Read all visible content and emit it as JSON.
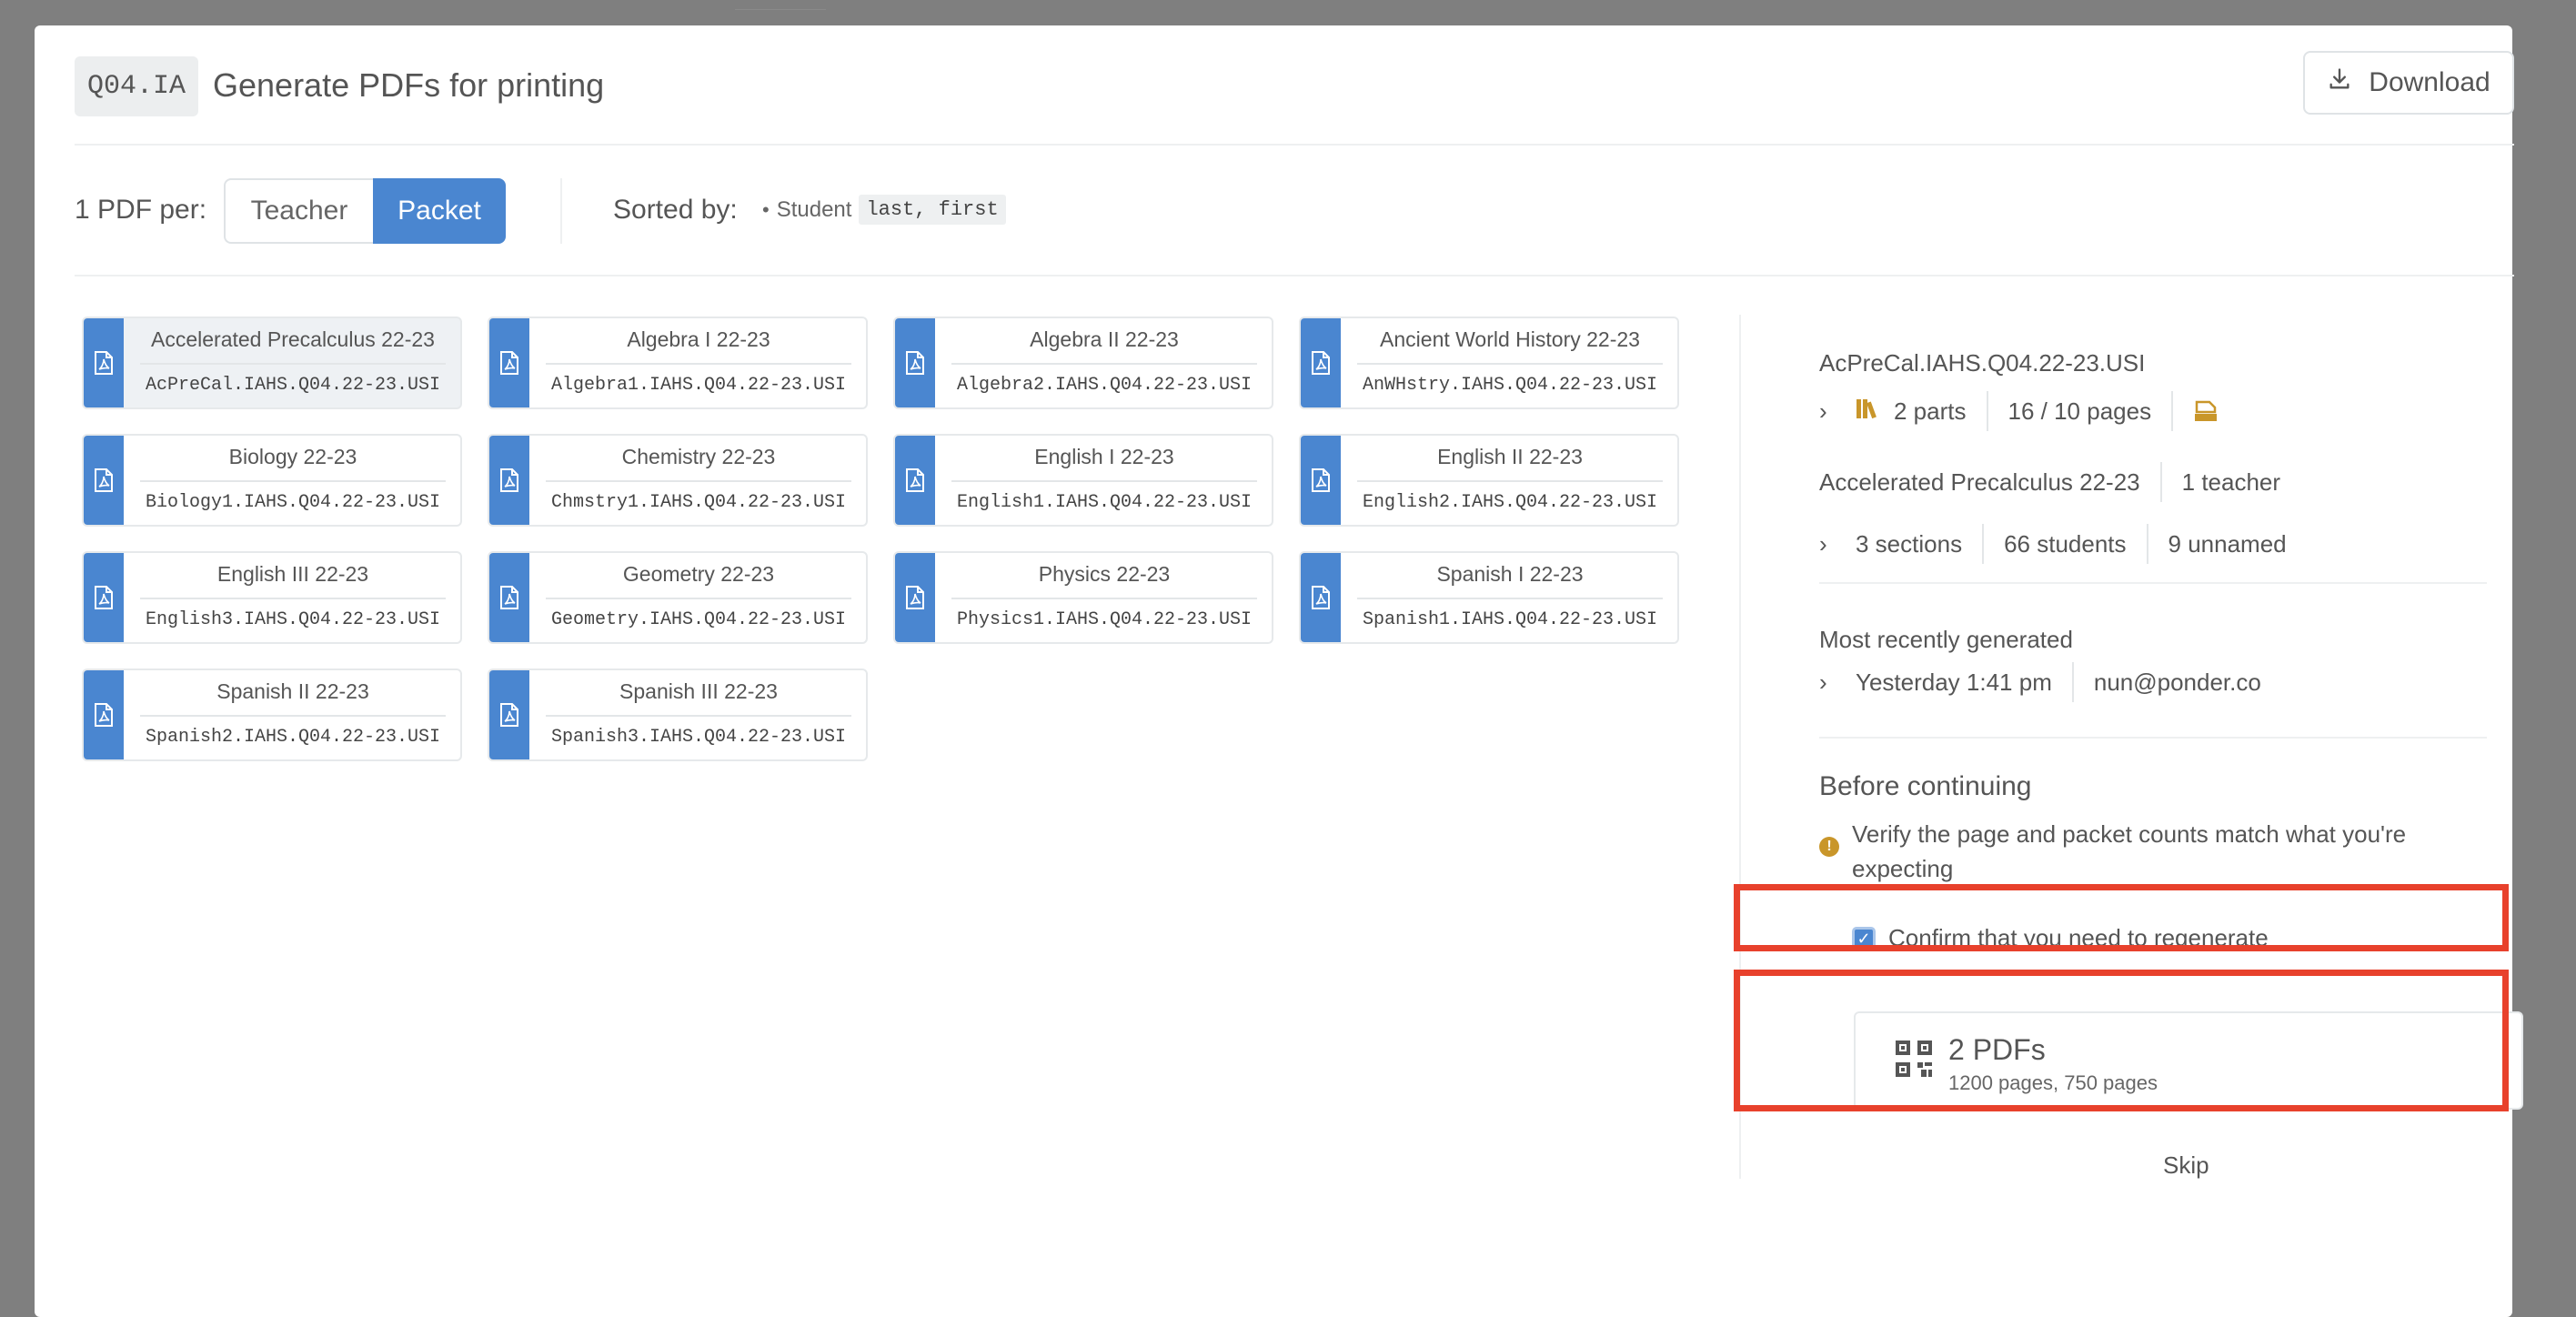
{
  "header": {
    "badge": "Q04.IA",
    "title": "Generate PDFs for printing",
    "download_label": "Download"
  },
  "options": {
    "per_label": "1 PDF per:",
    "teacher_label": "Teacher",
    "packet_label": "Packet",
    "selected": "Packet",
    "sorted_label": "Sorted by:",
    "sort_field": "Student",
    "sort_order": "last, first"
  },
  "cards": [
    {
      "name": "Accelerated Precalculus 22-23",
      "code": "AcPreCal.IAHS.Q04.22-23.USI",
      "selected": true
    },
    {
      "name": "Algebra I 22-23",
      "code": "Algebra1.IAHS.Q04.22-23.USI"
    },
    {
      "name": "Algebra II 22-23",
      "code": "Algebra2.IAHS.Q04.22-23.USI"
    },
    {
      "name": "Ancient World History 22-23",
      "code": "AnWHstry.IAHS.Q04.22-23.USI"
    },
    {
      "name": "Biology 22-23",
      "code": "Biology1.IAHS.Q04.22-23.USI"
    },
    {
      "name": "Chemistry 22-23",
      "code": "Chmstry1.IAHS.Q04.22-23.USI"
    },
    {
      "name": "English I 22-23",
      "code": "English1.IAHS.Q04.22-23.USI"
    },
    {
      "name": "English II 22-23",
      "code": "English2.IAHS.Q04.22-23.USI"
    },
    {
      "name": "English III 22-23",
      "code": "English3.IAHS.Q04.22-23.USI"
    },
    {
      "name": "Geometry 22-23",
      "code": "Geometry.IAHS.Q04.22-23.USI"
    },
    {
      "name": "Physics 22-23",
      "code": "Physics1.IAHS.Q04.22-23.USI"
    },
    {
      "name": "Spanish I 22-23",
      "code": "Spanish1.IAHS.Q04.22-23.USI"
    },
    {
      "name": "Spanish II 22-23",
      "code": "Spanish2.IAHS.Q04.22-23.USI"
    },
    {
      "name": "Spanish III 22-23",
      "code": "Spanish3.IAHS.Q04.22-23.USI"
    }
  ],
  "detail": {
    "code": "AcPreCal.IAHS.Q04.22-23.USI",
    "parts": "2 parts",
    "pages": "16 / 10 pages",
    "course": "Accelerated Precalculus 22-23",
    "teachers": "1 teacher",
    "sections": "3 sections",
    "students": "66 students",
    "unnamed": "9 unnamed",
    "recent_heading": "Most recently generated",
    "recent_time": "Yesterday 1:41 pm",
    "recent_user": "nun@ponder.co",
    "before_heading": "Before continuing",
    "warning": "Verify the page and packet counts match what you're expecting",
    "confirm_label": "Confirm that you need to regenerate",
    "confirm_checked": true,
    "pdf_count": "2 PDFs",
    "pdf_pages": "1200 pages, 750 pages",
    "skip_label": "Skip"
  },
  "colors": {
    "accent": "#4a86d0",
    "highlight": "#e8412c",
    "warning": "#c9962a",
    "backdrop": "#7f7f7f"
  },
  "icons": {
    "download": "download-icon",
    "pdf": "pdf-file-icon",
    "books": "books-icon",
    "print": "print-icon",
    "qr": "qr-code-icon",
    "chevron": "chevron-right-icon",
    "warning": "warning-icon"
  }
}
